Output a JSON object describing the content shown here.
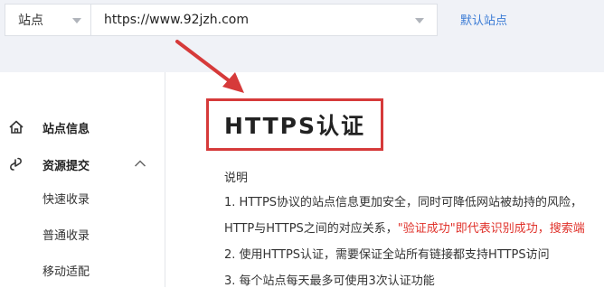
{
  "top": {
    "site_select_value": "站点",
    "url_select_value": "https://www.92jzh.com",
    "default_site_link": "默认站点"
  },
  "sidebar": {
    "items": [
      {
        "label": "站点信息",
        "icon": "home-icon"
      },
      {
        "label": "资源提交",
        "icon": "link-icon",
        "expanded": true
      },
      {
        "label": "快速收录"
      },
      {
        "label": "普通收录"
      },
      {
        "label": "移动适配"
      }
    ]
  },
  "main": {
    "title": "HTTPS认证",
    "desc_heading": "说明",
    "line1": "1. HTTPS协议的站点信息更加安全，同时可降低网站被劫持的风险，",
    "line2_prefix": "HTTP与HTTPS之间的对应关系，",
    "line2_highlight": "\"验证成功\"即代表识别成功，搜索端",
    "line3": "2. 使用HTTPS认证，需要保证全站所有链接都支持HTTPS访问",
    "line4": "3. 每个站点每天最多可使用3次认证功能"
  },
  "colors": {
    "accent": "#3a7bd5",
    "highlight_red": "#e0322b",
    "annotation_red": "#d63a3a",
    "topbar_bg": "#f0f2f7"
  }
}
